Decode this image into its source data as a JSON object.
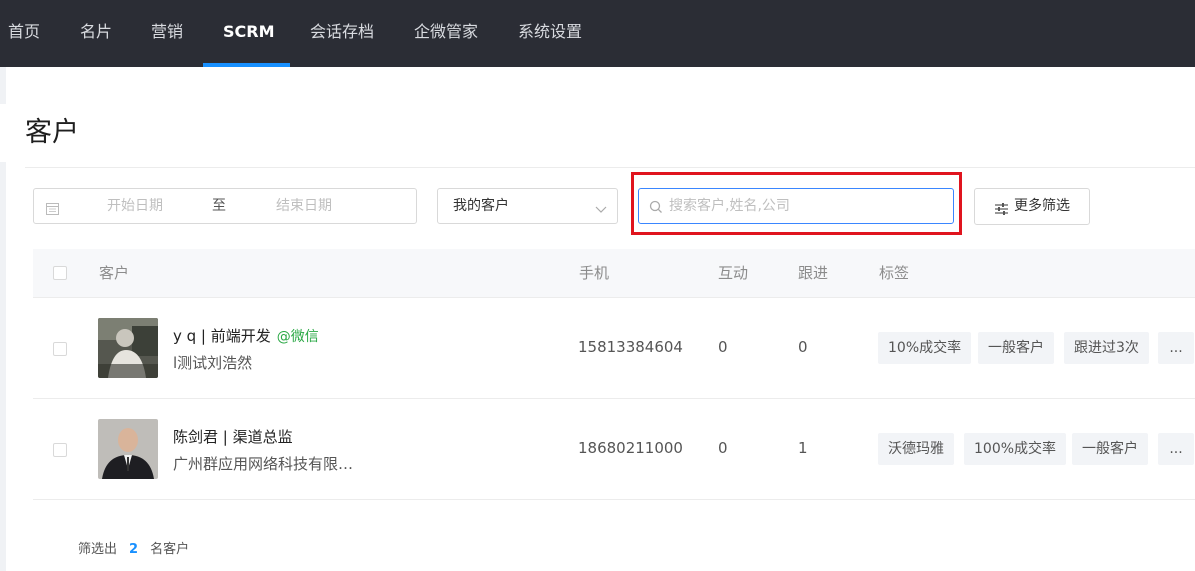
{
  "nav": {
    "items": [
      "首页",
      "名片",
      "营销",
      "SCRM",
      "会话存档",
      "企微管家",
      "系统设置"
    ],
    "active_index": 3
  },
  "page": {
    "title": "客户"
  },
  "filters": {
    "date_start_placeholder": "开始日期",
    "date_separator": "至",
    "date_end_placeholder": "结束日期",
    "owner_select_value": "我的客户",
    "search_placeholder": "搜索客户,姓名,公司",
    "more_filter_label": "更多筛选"
  },
  "table": {
    "headers": {
      "customer": "客户",
      "phone": "手机",
      "interaction": "互动",
      "followup": "跟进",
      "tags": "标签"
    },
    "rows": [
      {
        "name": "y q | 前端开发",
        "wechat": "@微信",
        "company": "l测试刘浩然",
        "phone": "15813384604",
        "interaction": "0",
        "followup": "0",
        "tags": [
          "10%成交率",
          "一般客户",
          "跟进过3次",
          "..."
        ]
      },
      {
        "name": "陈剑君 | 渠道总监",
        "wechat": "",
        "company": "广州群应用网络科技有限…",
        "phone": "18680211000",
        "interaction": "0",
        "followup": "1",
        "tags": [
          "沃德玛雅",
          "100%成交率",
          "一般客户",
          "..."
        ]
      }
    ]
  },
  "footer": {
    "prefix": "筛选出",
    "count": "2",
    "suffix": "名客户"
  },
  "colors": {
    "nav_bg": "#2b2d35",
    "accent": "#1890ff",
    "highlight": "#e0141e",
    "wechat_green": "#2aa845"
  }
}
